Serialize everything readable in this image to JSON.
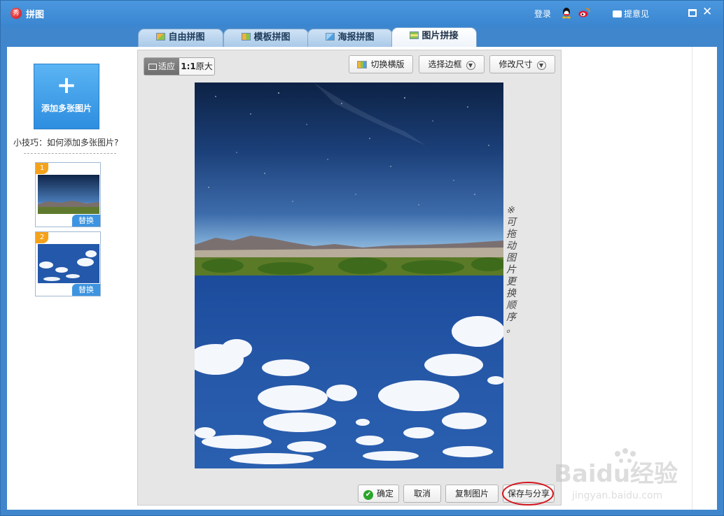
{
  "window": {
    "title": "拼图",
    "login_label": "登录",
    "feedback_label": "提意见",
    "accent_color": "#3f86cc"
  },
  "tabs": [
    {
      "label": "自由拼图",
      "icon": "free-collage-icon",
      "active": false
    },
    {
      "label": "模板拼图",
      "icon": "template-collage-icon",
      "active": false
    },
    {
      "label": "海报拼图",
      "icon": "poster-collage-icon",
      "active": false
    },
    {
      "label": "图片拼接",
      "icon": "image-stitch-icon",
      "active": true
    }
  ],
  "sidebar": {
    "add_button_plus": "+",
    "add_button_label": "添加多张图片",
    "tip": "小技巧：如何添加多张图片?",
    "thumbnails": [
      {
        "number": "1",
        "replace_label": "替换"
      },
      {
        "number": "2",
        "replace_label": "替换"
      }
    ]
  },
  "toolbar": {
    "fit_label": "适应",
    "original_prefix": "1:1",
    "original_label": "原大",
    "toggle_layout_label": "切换横版",
    "choose_border_label": "选择边框",
    "resize_label": "修改尺寸"
  },
  "annotation": {
    "lines": [
      "※",
      "可",
      "拖",
      "动",
      "图",
      "片",
      "更",
      "换",
      "顺",
      "序",
      "。"
    ]
  },
  "footer": {
    "confirm_label": "确定",
    "cancel_label": "取消",
    "copy_label": "复制图片",
    "save_share_label": "保存与分享"
  },
  "watermark": {
    "brand": "Baidu经验",
    "url": "jingyan.baidu.com"
  }
}
